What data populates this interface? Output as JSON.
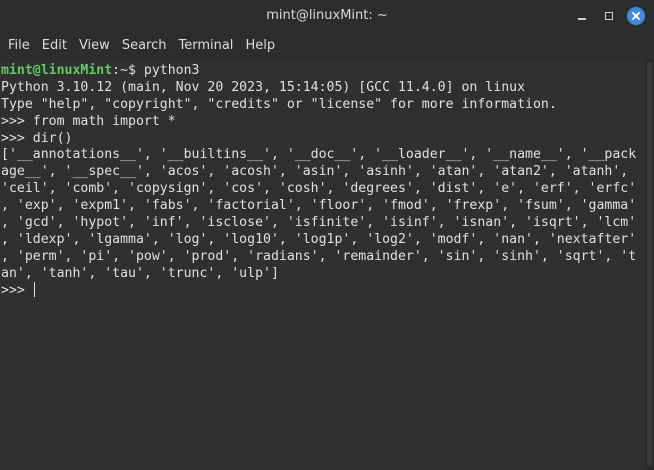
{
  "window": {
    "title": "mint@linuxMint: ~"
  },
  "menu": {
    "items": [
      "File",
      "Edit",
      "View",
      "Search",
      "Terminal",
      "Help"
    ]
  },
  "terminal": {
    "prompt_user": "mint@linuxMint",
    "prompt_path": ":~$ ",
    "command": "python3",
    "lines": [
      "Python 3.10.12 (main, Nov 20 2023, 15:14:05) [GCC 11.4.0] on linux",
      "Type \"help\", \"copyright\", \"credits\" or \"license\" for more information.",
      ">>> from math import *",
      ">>> dir()",
      "['__annotations__', '__builtins__', '__doc__', '__loader__', '__name__', '__pack",
      "age__', '__spec__', 'acos', 'acosh', 'asin', 'asinh', 'atan', 'atan2', 'atanh',",
      "'ceil', 'comb', 'copysign', 'cos', 'cosh', 'degrees', 'dist', 'e', 'erf', 'erfc'",
      ", 'exp', 'expm1', 'fabs', 'factorial', 'floor', 'fmod', 'frexp', 'fsum', 'gamma'",
      ", 'gcd', 'hypot', 'inf', 'isclose', 'isfinite', 'isinf', 'isnan', 'isqrt', 'lcm'",
      ", 'ldexp', 'lgamma', 'log', 'log10', 'log1p', 'log2', 'modf', 'nan', 'nextafter'",
      ", 'perm', 'pi', 'pow', 'prod', 'radians', 'remainder', 'sin', 'sinh', 'sqrt', 't",
      "an', 'tanh', 'tau', 'trunc', 'ulp']"
    ],
    "current_prompt": ">>> "
  },
  "colors": {
    "prompt_user": "#64c864",
    "close_button": "#3d8be0",
    "background": "#303030"
  }
}
